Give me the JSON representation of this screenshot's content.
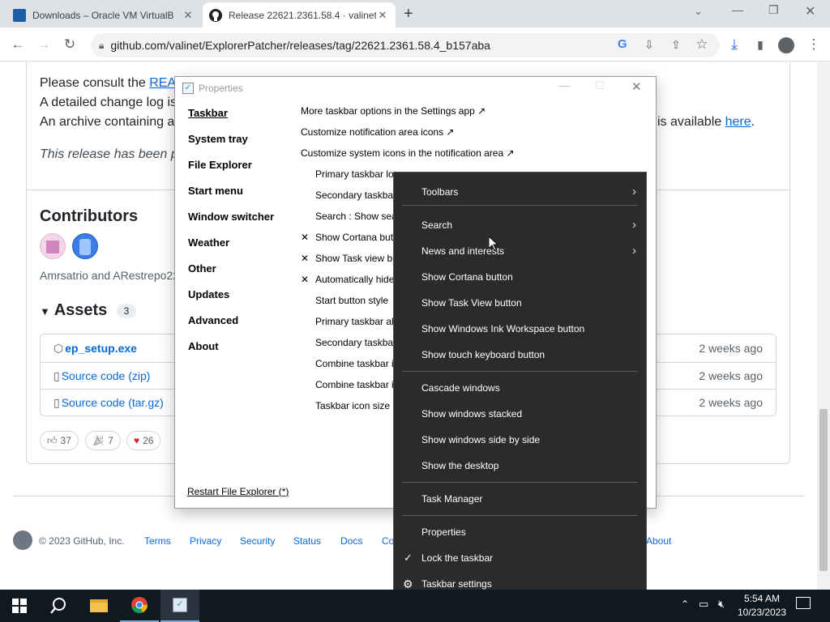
{
  "browser": {
    "tabs": [
      {
        "title": "Downloads – Oracle VM VirtualB"
      },
      {
        "title": "Release 22621.2361.58.4 · valinet"
      }
    ],
    "url": "github.com/valinet/ExplorerPatcher/releases/tag/22621.2361.58.4_b157aba"
  },
  "page": {
    "line1_prefix": "Please consult the ",
    "line1_link": "READ",
    "line2": "A detailed change log is",
    "line3_prefix": "An archive containing a",
    "line3_suffix": "is available ",
    "line3_link": "here",
    "line3_end": ".",
    "italic": "This release has been pu",
    "contributors_title": "Contributors",
    "contributors_names": "Amrsatrio and ARestrepo22",
    "assets_title": "Assets",
    "assets_count": "3",
    "assets": [
      {
        "name": "ep_setup.exe",
        "time": "2 weeks ago"
      },
      {
        "name": "Source code (zip)",
        "time": "2 weeks ago"
      },
      {
        "name": "Source code (tar.gz)",
        "time": "2 weeks ago"
      }
    ],
    "reactions": [
      "37",
      "7",
      "26"
    ],
    "footer": {
      "copyright": "© 2023 GitHub, Inc.",
      "links": [
        "Terms",
        "Privacy",
        "Security",
        "Status",
        "Docs",
        "Co"
      ],
      "about": "About"
    }
  },
  "props": {
    "title": "Properties",
    "nav": [
      "Taskbar",
      "System tray",
      "File Explorer",
      "Start menu",
      "Window switcher",
      "Weather",
      "Other",
      "Updates",
      "Advanced",
      "About"
    ],
    "restart": "Restart File Explorer (*)",
    "options": [
      {
        "check": "",
        "text": "More taskbar options in the Settings app ↗",
        "indent": false
      },
      {
        "check": "",
        "text": "Customize notification area icons ↗",
        "indent": false
      },
      {
        "check": "",
        "text": "Customize system icons in the notification area ↗",
        "indent": false
      },
      {
        "check": "",
        "text": "Primary taskbar lo",
        "indent": true
      },
      {
        "check": "",
        "text": "Secondary taskbar",
        "indent": true
      },
      {
        "check": "",
        "text": "Search : Show sear",
        "indent": true
      },
      {
        "check": "✕",
        "text": "Show Cortana but",
        "indent": true
      },
      {
        "check": "✕",
        "text": "Show Task view bu",
        "indent": true
      },
      {
        "check": "✕",
        "text": "Automatically hide",
        "indent": true
      },
      {
        "check": "",
        "text": "Start button style",
        "indent": true
      },
      {
        "check": "",
        "text": "Primary taskbar ali",
        "indent": true
      },
      {
        "check": "",
        "text": "Secondary taskbar",
        "indent": true
      },
      {
        "check": "",
        "text": "Combine taskbar i",
        "indent": true
      },
      {
        "check": "",
        "text": "Combine taskbar i",
        "indent": true
      },
      {
        "check": "",
        "text": "Taskbar icon size :",
        "indent": true
      }
    ]
  },
  "context_menu": {
    "items": [
      {
        "label": "Toolbars",
        "submenu": true
      },
      {
        "label": "Search",
        "submenu": true
      },
      {
        "label": "News and interests",
        "submenu": true
      },
      {
        "label": "Show Cortana button"
      },
      {
        "label": "Show Task View button"
      },
      {
        "label": "Show Windows Ink Workspace button"
      },
      {
        "label": "Show touch keyboard button"
      },
      {
        "label": "Cascade windows"
      },
      {
        "label": "Show windows stacked"
      },
      {
        "label": "Show windows side by side"
      },
      {
        "label": "Show the desktop"
      },
      {
        "label": "Task Manager"
      },
      {
        "label": "Properties"
      },
      {
        "label": "Lock the taskbar",
        "checked": true
      },
      {
        "label": "Taskbar settings",
        "icon": "gear-icon"
      }
    ]
  },
  "taskbar": {
    "time": "5:54 AM",
    "date": "10/23/2023"
  },
  "colors": {
    "link": "#0969da",
    "menu_bg": "#2b2b2b",
    "taskbar_bg": "#101820"
  }
}
